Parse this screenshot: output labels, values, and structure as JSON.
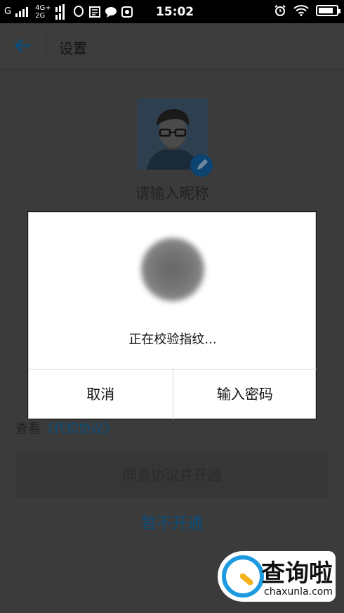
{
  "status_bar": {
    "carrier1": "G",
    "net_top": "4G+",
    "net_bottom": "2G",
    "time": "15:02"
  },
  "header": {
    "title": "设置"
  },
  "profile": {
    "nickname_placeholder": "请输入昵称"
  },
  "agreement": {
    "prefix": "查看",
    "link": "《代扣协议》"
  },
  "buttons": {
    "agree_label": "同意协议并开通",
    "later_label": "暂不开通"
  },
  "dialog": {
    "message": "正在校验指纹...",
    "cancel_label": "取消",
    "password_label": "输入密码"
  },
  "watermark": {
    "brand": "查询啦",
    "domain": "chaxunla.com"
  },
  "colors": {
    "accent": "#0b4d7a",
    "overlay": "#3b3b3b",
    "watermark_blue": "#1e9be0",
    "watermark_orange": "#f5b21a"
  }
}
